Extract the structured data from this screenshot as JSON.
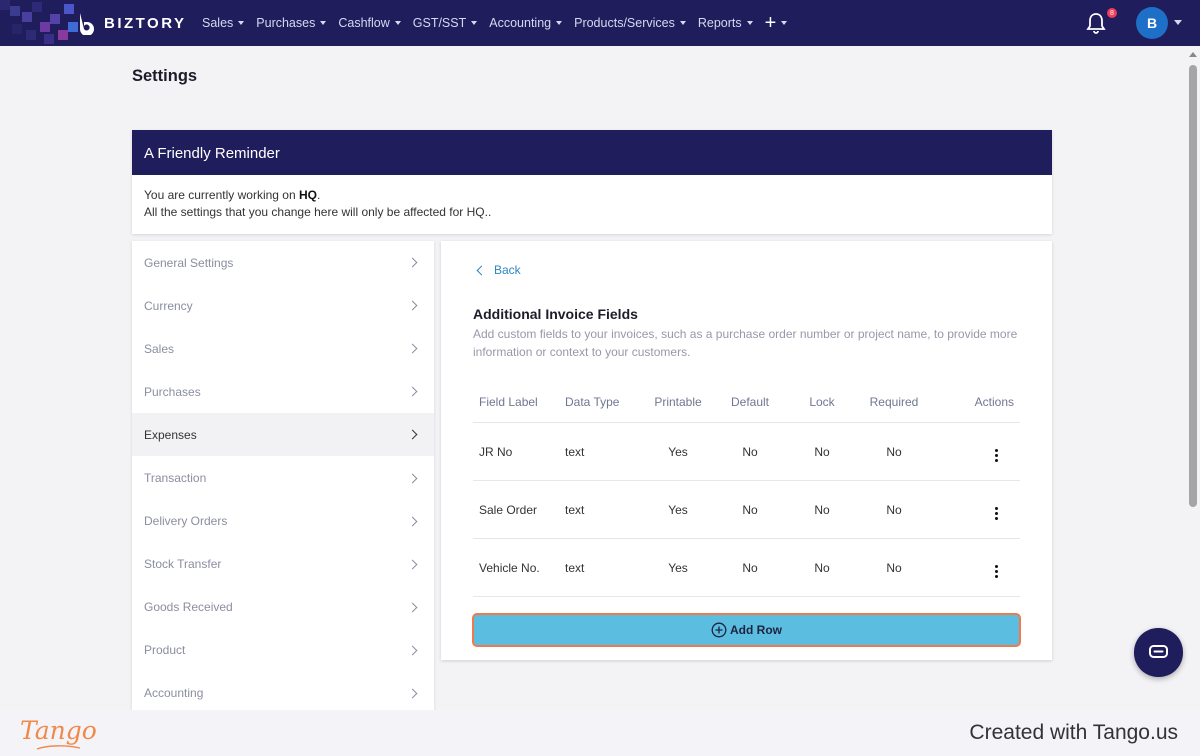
{
  "topbar": {
    "brand": "BIZTORY",
    "nav": [
      "Sales",
      "Purchases",
      "Cashflow",
      "GST/SST",
      "Accounting",
      "Products/Services",
      "Reports"
    ],
    "notification_count": "8",
    "avatar_initial": "B",
    "icons": [
      "plus-icon",
      "bell-icon",
      "chevron-down-icon"
    ]
  },
  "page": {
    "title": "Settings"
  },
  "reminder": {
    "title": "A Friendly Reminder",
    "line1_prefix": "You are currently working on ",
    "line1_branch": "HQ",
    "line1_suffix": ".",
    "line2": "All the settings that you change here will only be affected for HQ.."
  },
  "sidebar": {
    "items": [
      {
        "label": "General Settings"
      },
      {
        "label": "Currency"
      },
      {
        "label": "Sales"
      },
      {
        "label": "Purchases"
      },
      {
        "label": "Expenses",
        "active": true
      },
      {
        "label": "Transaction"
      },
      {
        "label": "Delivery Orders"
      },
      {
        "label": "Stock Transfer"
      },
      {
        "label": "Goods Received"
      },
      {
        "label": "Product"
      },
      {
        "label": "Accounting"
      }
    ]
  },
  "panel": {
    "back_label": "Back",
    "title": "Additional Invoice Fields",
    "description": "Add custom fields to your invoices, such as a purchase order number or project name, to provide more information or context to your customers.",
    "columns": [
      "Field Label",
      "Data Type",
      "Printable",
      "Default",
      "Lock",
      "Required",
      "Actions"
    ],
    "rows": [
      {
        "label": "JR No",
        "type": "text",
        "printable": "Yes",
        "default": "No",
        "lock": "No",
        "required": "No"
      },
      {
        "label": "Sale Order",
        "type": "text",
        "printable": "Yes",
        "default": "No",
        "lock": "No",
        "required": "No"
      },
      {
        "label": "Vehicle No.",
        "type": "text",
        "printable": "Yes",
        "default": "No",
        "lock": "No",
        "required": "No"
      }
    ],
    "add_row_label": "Add Row"
  },
  "footer": {
    "tango_logo": "Tango",
    "created_text": "Created with Tango.us"
  },
  "colors": {
    "nav_bg": "#1f1d5c",
    "accent_blue": "#5bbee0",
    "highlight_orange": "#ef7a4c",
    "link_blue": "#2e86c1"
  }
}
